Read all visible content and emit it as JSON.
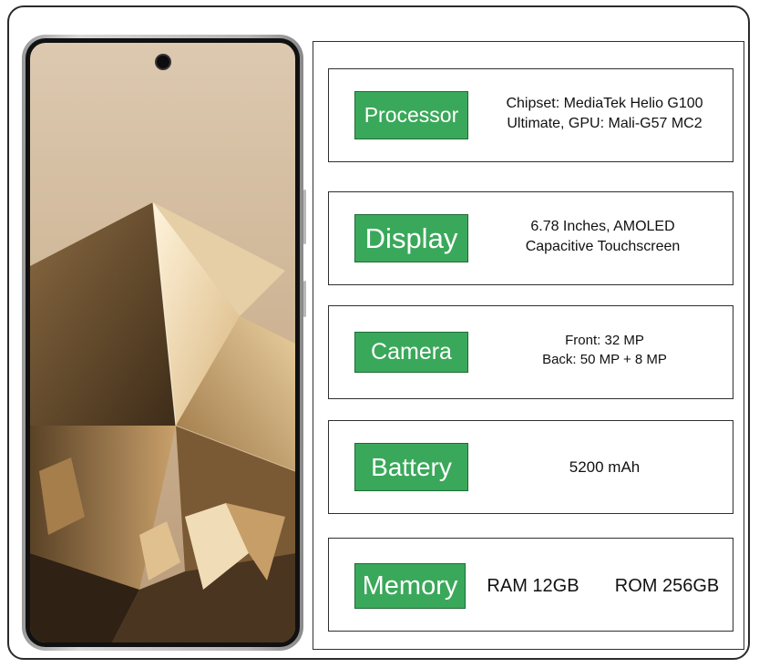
{
  "specs": {
    "processor": {
      "label": "Processor",
      "line1": "Chipset: MediaTek Helio G100",
      "line2": "Ultimate, GPU: Mali-G57 MC2"
    },
    "display": {
      "label": "Display",
      "line1": "6.78 Inches,  AMOLED",
      "line2": "Capacitive Touchscreen"
    },
    "camera": {
      "label": "Camera",
      "line1": "Front: 32 MP",
      "line2": "Back: 50 MP + 8 MP"
    },
    "battery": {
      "label": "Battery",
      "value": "5200 mAh"
    },
    "memory": {
      "label": "Memory",
      "ram": "RAM 12GB",
      "rom": "ROM 256GB"
    }
  },
  "colors": {
    "label_green": "#3aa85a",
    "border": "#2f2f2f"
  },
  "icons": {
    "front_camera": "camera-hole"
  }
}
